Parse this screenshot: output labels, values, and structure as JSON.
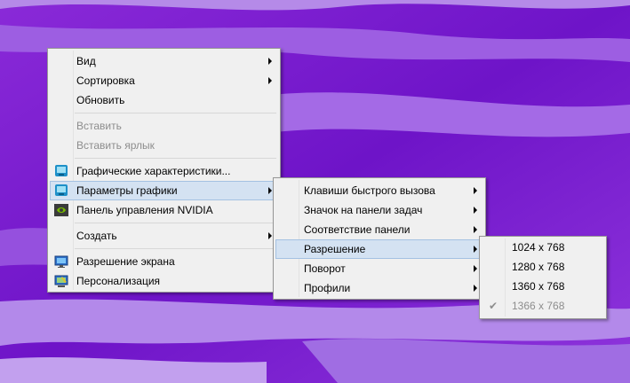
{
  "context_menu": {
    "items": [
      {
        "label": "Вид"
      },
      {
        "label": "Сортировка"
      },
      {
        "label": "Обновить"
      },
      {
        "label": "Вставить"
      },
      {
        "label": "Вставить ярлык"
      },
      {
        "label": "Графические характеристики...",
        "icon": "intel-graphics-icon"
      },
      {
        "label": "Параметры графики",
        "icon": "intel-graphics-icon"
      },
      {
        "label": "Панель управления NVIDIA",
        "icon": "nvidia-icon"
      },
      {
        "label": "Создать"
      },
      {
        "label": "Разрешение экрана",
        "icon": "display-icon"
      },
      {
        "label": "Персонализация",
        "icon": "personalize-icon"
      }
    ]
  },
  "graphics_submenu": {
    "items": [
      {
        "label": "Клавиши быстрого вызова"
      },
      {
        "label": "Значок на панели задач"
      },
      {
        "label": "Соответствие панели"
      },
      {
        "label": "Разрешение"
      },
      {
        "label": "Поворот"
      },
      {
        "label": "Профили"
      }
    ]
  },
  "resolution_submenu": {
    "items": [
      {
        "label": "1024 x 768"
      },
      {
        "label": "1280 x 768"
      },
      {
        "label": "1360 x 768"
      },
      {
        "label": "1366 x 768",
        "checked": true
      }
    ]
  },
  "colors": {
    "highlight_bg": "#d4e2f2",
    "highlight_border": "#a4c1e2",
    "menu_bg": "#f0f0f0",
    "desktop_purple": "#7b1fd1"
  }
}
